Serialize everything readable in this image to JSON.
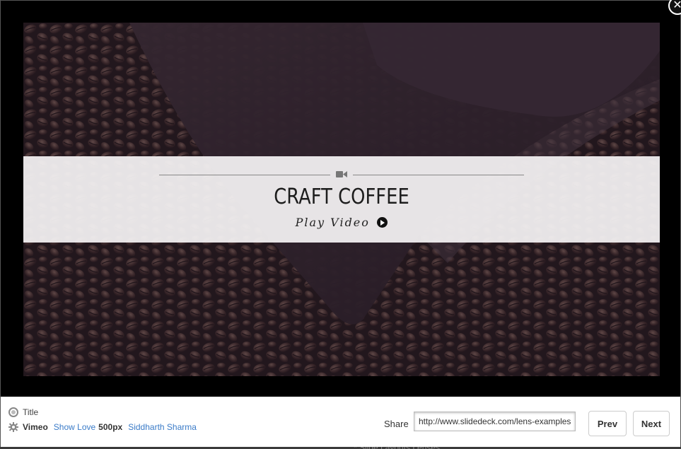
{
  "background": {
    "peek_text": "* Slide Layouts Lenses"
  },
  "lightbox": {
    "close_glyph": "✕",
    "slide": {
      "title": "CRAFT COFFEE",
      "play_label": "Play Video",
      "media_icon": "video-camera-icon"
    }
  },
  "footer": {
    "title_label": "Title",
    "source": "Vimeo",
    "show_love_link": "Show Love",
    "secondary_source": "500px",
    "author_link": "Siddharth Sharma",
    "share": {
      "label": "Share",
      "url_value": "http://www.slidedeck.com/lens-examples/"
    },
    "prev_label": "Prev",
    "next_label": "Next"
  },
  "colors": {
    "link": "#3a7bc8",
    "frame": "#000000",
    "band": "#f5f3f4"
  }
}
